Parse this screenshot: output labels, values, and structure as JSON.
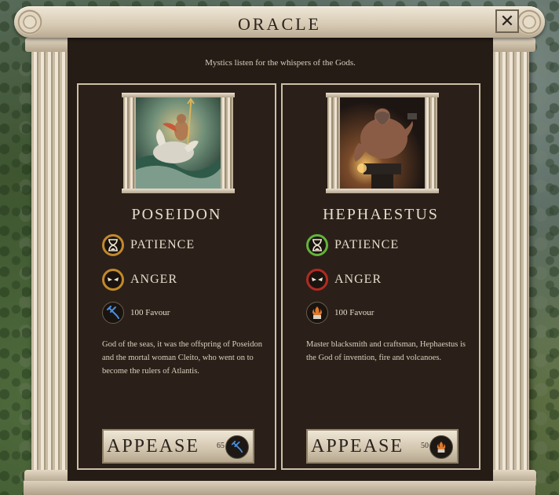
{
  "window": {
    "title": "ORACLE",
    "close_symbol": "✕",
    "subtitle": "Mystics listen for the whispers of the Gods."
  },
  "gods": [
    {
      "name": "POSEIDON",
      "patience_label": "PATIENCE",
      "patience_ring_color": "#c2892b",
      "anger_label": "ANGER",
      "anger_ring_color": "#c2892b",
      "favour_text": "100 Favour",
      "favour_icon": "trident-icon",
      "description": "God of the seas, it was the offspring of Poseidon and the mortal woman Cleito, who went on to become the rulers of Atlantis.",
      "appease_label": "APPEASE",
      "appease_cost": "65"
    },
    {
      "name": "HEPHAESTUS",
      "patience_label": "PATIENCE",
      "patience_ring_color": "#63b33a",
      "anger_label": "ANGER",
      "anger_ring_color": "#b22a22",
      "favour_text": "100 Favour",
      "favour_icon": "forge-flame-icon",
      "description": "Master blacksmith and craftsman, Hephaestus is the God of invention, fire and volcanoes.",
      "appease_label": "APPEASE",
      "appease_cost": "50"
    }
  ]
}
